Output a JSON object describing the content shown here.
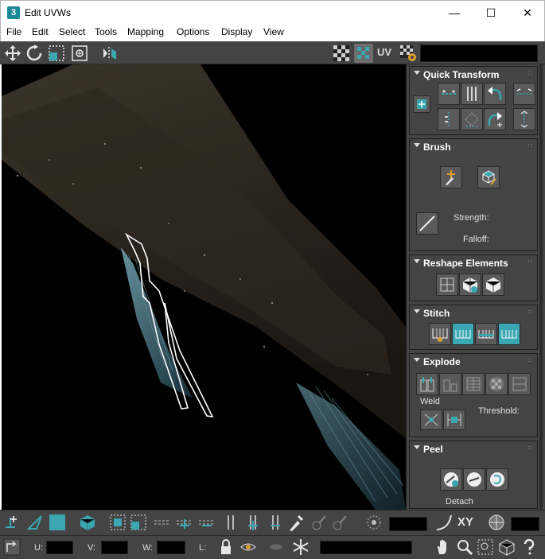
{
  "window": {
    "app_icon_text": "3",
    "title": "Edit UVWs",
    "minimize": "—",
    "maximize": "☐",
    "close": "✕"
  },
  "menu": [
    "File",
    "Edit",
    "Select",
    "Tools",
    "Mapping",
    "Options",
    "Display",
    "View"
  ],
  "toolbar_top": {
    "uv_label": "UV"
  },
  "panel": {
    "quick_transform": {
      "title": "Quick Transform"
    },
    "brush": {
      "title": "Brush",
      "strength_label": "Strength:",
      "falloff_label": "Falloff:"
    },
    "reshape": {
      "title": "Reshape Elements"
    },
    "stitch": {
      "title": "Stitch"
    },
    "explode": {
      "title": "Explode",
      "weld_label": "Weld",
      "threshold_label": "Threshold:"
    },
    "peel": {
      "title": "Peel",
      "detach_label": "Detach"
    }
  },
  "bottom": {
    "xy_label": "XY",
    "u_label": "U:",
    "v_label": "V:",
    "w_label": "W:",
    "l_label": "L:"
  },
  "colors": {
    "accent": "#3aa7b3",
    "panel_bg": "#444444",
    "viewport_bg": "#000000"
  }
}
